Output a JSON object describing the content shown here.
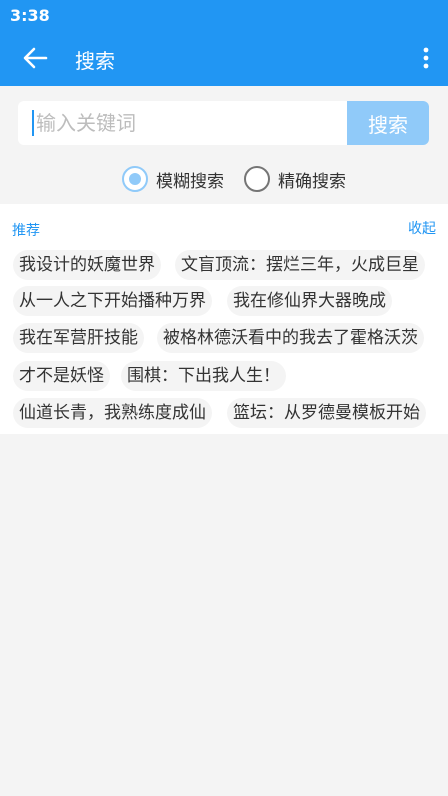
{
  "status_bar": {
    "time": "3:38"
  },
  "header": {
    "title": "搜索",
    "back_icon": "arrow-left-icon",
    "more_icon": "more-vertical-icon"
  },
  "search": {
    "placeholder": "输入关键词",
    "value": "",
    "button_label": "搜索"
  },
  "mode": {
    "options": [
      {
        "label": "模糊搜索",
        "checked": true
      },
      {
        "label": "精确搜索",
        "checked": false
      }
    ]
  },
  "recommend": {
    "title": "推荐",
    "collapse_label": "收起",
    "tags": [
      "我设计的妖魔世界",
      "文盲顶流：摆烂三年，火成巨星",
      "从一人之下开始播种万界",
      "我在修仙界大器晚成",
      "我在军营肝技能",
      "被格林德沃看中的我去了霍格沃茨",
      "才不是妖怪",
      "围棋：下出我人生！",
      "仙道长青，我熟练度成仙",
      "篮坛：从罗德曼模板开始"
    ]
  },
  "colors": {
    "primary": "#2196f3",
    "button_light": "#90caf9",
    "background": "#f4f4f4",
    "tag_background": "#f4f4f4"
  }
}
